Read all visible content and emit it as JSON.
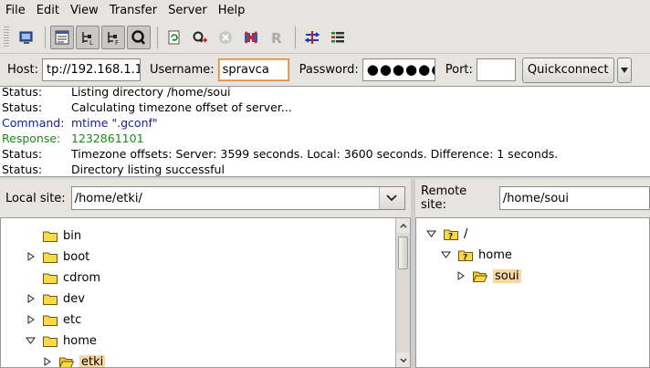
{
  "menu": [
    "File",
    "Edit",
    "View",
    "Transfer",
    "Server",
    "Help"
  ],
  "toolbar": {
    "icons": [
      "site-manager-icon",
      "message-log-icon",
      "local-tree-icon",
      "remote-tree-icon",
      "queue-icon",
      "refresh-icon",
      "process-queue-icon",
      "cancel-icon",
      "disconnect-icon",
      "reconnect-icon",
      "directory-compare-icon",
      "filter-icon"
    ]
  },
  "quickconnect": {
    "host_label": "Host:",
    "host_value": "tp://192.168.1.1",
    "username_label": "Username:",
    "username_value": "spravca",
    "password_label": "Password:",
    "password_value": "●●●●●●",
    "port_label": "Port:",
    "port_value": "",
    "button_label": "Quickconnect"
  },
  "log": [
    {
      "kind": "Status:",
      "text": "Listing directory /home/soui",
      "type": "status"
    },
    {
      "kind": "Status:",
      "text": "Calculating timezone offset of server...",
      "type": "status"
    },
    {
      "kind": "Command:",
      "text": "mtime \".gconf\"",
      "type": "command"
    },
    {
      "kind": "Response:",
      "text": "1232861101",
      "type": "response"
    },
    {
      "kind": "Status:",
      "text": "Timezone offsets: Server: 3599 seconds. Local: 3600 seconds. Difference: 1 seconds.",
      "type": "status"
    },
    {
      "kind": "Status:",
      "text": "Directory listing successful",
      "type": "status"
    }
  ],
  "local": {
    "label": "Local site:",
    "path": "/home/etki/",
    "tree": [
      {
        "name": "bin",
        "expander": "none"
      },
      {
        "name": "boot",
        "expander": "collapsed"
      },
      {
        "name": "cdrom",
        "expander": "none"
      },
      {
        "name": "dev",
        "expander": "collapsed"
      },
      {
        "name": "etc",
        "expander": "collapsed"
      },
      {
        "name": "home",
        "expander": "expanded"
      },
      {
        "name": "etki",
        "expander": "collapsed"
      }
    ]
  },
  "remote": {
    "label": "Remote site:",
    "path": "/home/soui",
    "tree": [
      {
        "name": "/",
        "expander": "expanded"
      },
      {
        "name": "home",
        "expander": "expanded"
      },
      {
        "name": "soui",
        "expander": "collapsed"
      }
    ]
  }
}
